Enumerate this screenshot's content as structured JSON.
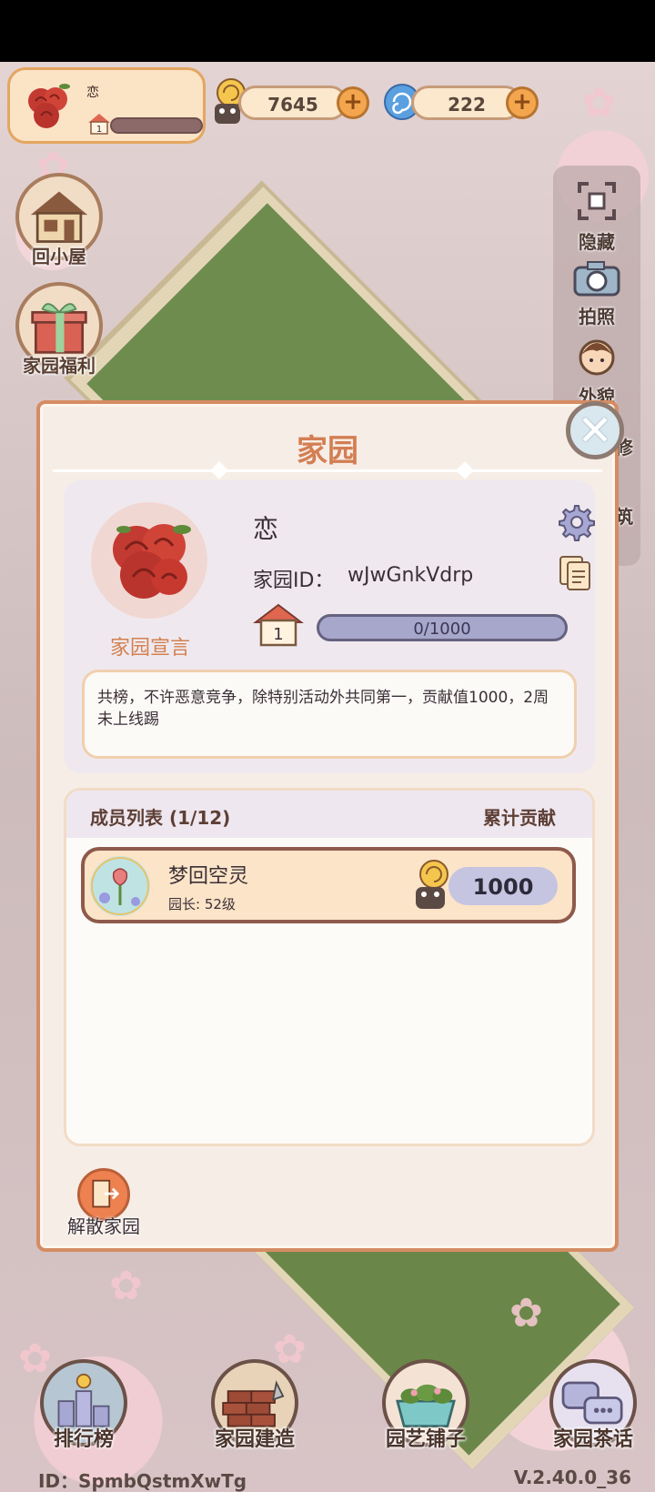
{
  "top_bar": {
    "home_name": "恋",
    "home_level": "1",
    "coins": "7645",
    "gems": "222",
    "plus_label": "+"
  },
  "left_menu": {
    "back_home": "回小屋",
    "welfare": "家园福利"
  },
  "right_menu": {
    "hide": "隐藏",
    "photo": "拍照",
    "appearance": "外貌",
    "decorate_partial": "修",
    "build_partial": "筑"
  },
  "modal": {
    "title": "家园",
    "close_glyph": "✕",
    "home_name": "恋",
    "home_id_label": "家园ID：",
    "home_id_value": "wJwGnkVdrp",
    "level": "1",
    "progress_text": "0/1000",
    "progress": 0.0,
    "manifesto_link": "家园宣言",
    "manifesto_text": "共榜，不许恶意竞争，除特别活动外共同第一，贡献值1000，2周未上线踢",
    "members_title": "成员列表 (1/12)",
    "members_contrib_header": "累计贡献",
    "members": [
      {
        "name": "梦回空灵",
        "role": "园长: 52级",
        "contribution": "1000"
      }
    ],
    "disband_label": "解散家园"
  },
  "bottom_nav": {
    "ranking": "排行榜",
    "build": "家园建造",
    "shop": "园艺铺子",
    "tea": "家园茶话"
  },
  "footer": {
    "player_id": "ID：SpmbQstmXwTg",
    "version": "V.2.40.0_36"
  },
  "colors": {
    "modal_accent": "#d37e53",
    "progress_fill": "#a7a7cc",
    "member_row_bg": "#fbe4c8"
  },
  "icons": [
    "rose-icon",
    "house-level-icon",
    "snail-coin-icon",
    "swirl-gem-icon",
    "plus-icon",
    "house-icon",
    "gift-icon",
    "hide-icon",
    "camera-icon",
    "face-icon",
    "gear-icon",
    "copy-icon",
    "close-icon",
    "exit-door-icon",
    "ranking-icon",
    "bricks-icon",
    "planter-icon",
    "chat-bubbles-icon"
  ]
}
